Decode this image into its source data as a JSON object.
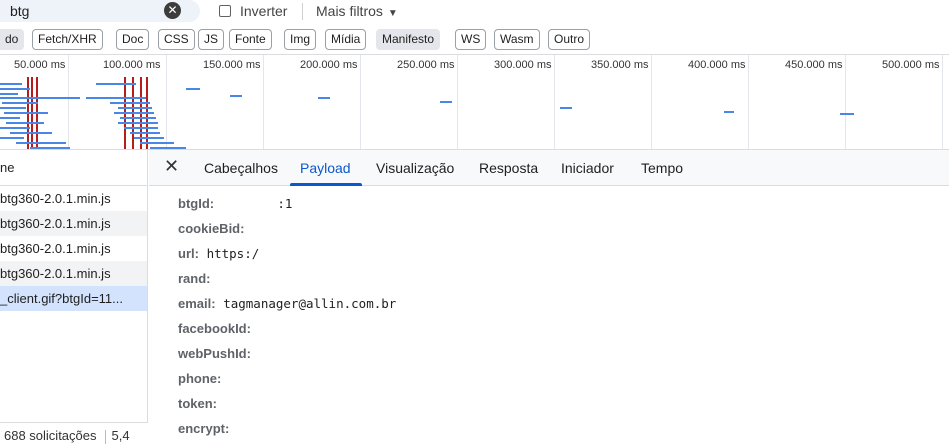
{
  "filter": {
    "search_value": "btg",
    "invert_label": "Inverter",
    "more_filters_label": "Mais filtros"
  },
  "type_filters": [
    "do",
    "Fetch/XHR",
    "Doc",
    "CSS",
    "JS",
    "Fonte",
    "Img",
    "Mídia",
    "Manifesto",
    "WS",
    "Wasm",
    "Outro"
  ],
  "timeline": {
    "ticks": [
      "50.000 ms",
      "100.000 ms",
      "150.000 ms",
      "200.000 ms",
      "250.000 ms",
      "300.000 ms",
      "350.000 ms",
      "400.000 ms",
      "450.000 ms",
      "500.000 ms"
    ]
  },
  "request_list": {
    "header": "ne",
    "rows": [
      "btg360-2.0.1.min.js",
      "btg360-2.0.1.min.js",
      "btg360-2.0.1.min.js",
      "btg360-2.0.1.min.js",
      "_client.gif?btgId=11..."
    ],
    "status_count": "688 solicitações",
    "status_size": "5,4"
  },
  "detail": {
    "tabs": [
      "Cabeçalhos",
      "Payload",
      "Visualização",
      "Resposta",
      "Iniciador",
      "Tempo"
    ],
    "active_tab": "Payload",
    "payload": [
      {
        "key": "btgId:",
        "value": ":1"
      },
      {
        "key": "cookieBid:",
        "value": ""
      },
      {
        "key": "url:",
        "value": "https:/"
      },
      {
        "key": "rand:",
        "value": ""
      },
      {
        "key": "email:",
        "value": "tagmanager@allin.com.br"
      },
      {
        "key": "facebookId:",
        "value": ""
      },
      {
        "key": "webPushId:",
        "value": ""
      },
      {
        "key": "phone:",
        "value": ""
      },
      {
        "key": "token:",
        "value": ""
      },
      {
        "key": "encrypt:",
        "value": ""
      }
    ]
  },
  "colors": {
    "accent": "#0b57d0",
    "selected_row": "#d3e3fd",
    "timeline_bar": "#4a85e8",
    "timeline_marker": "#b71c1c"
  }
}
